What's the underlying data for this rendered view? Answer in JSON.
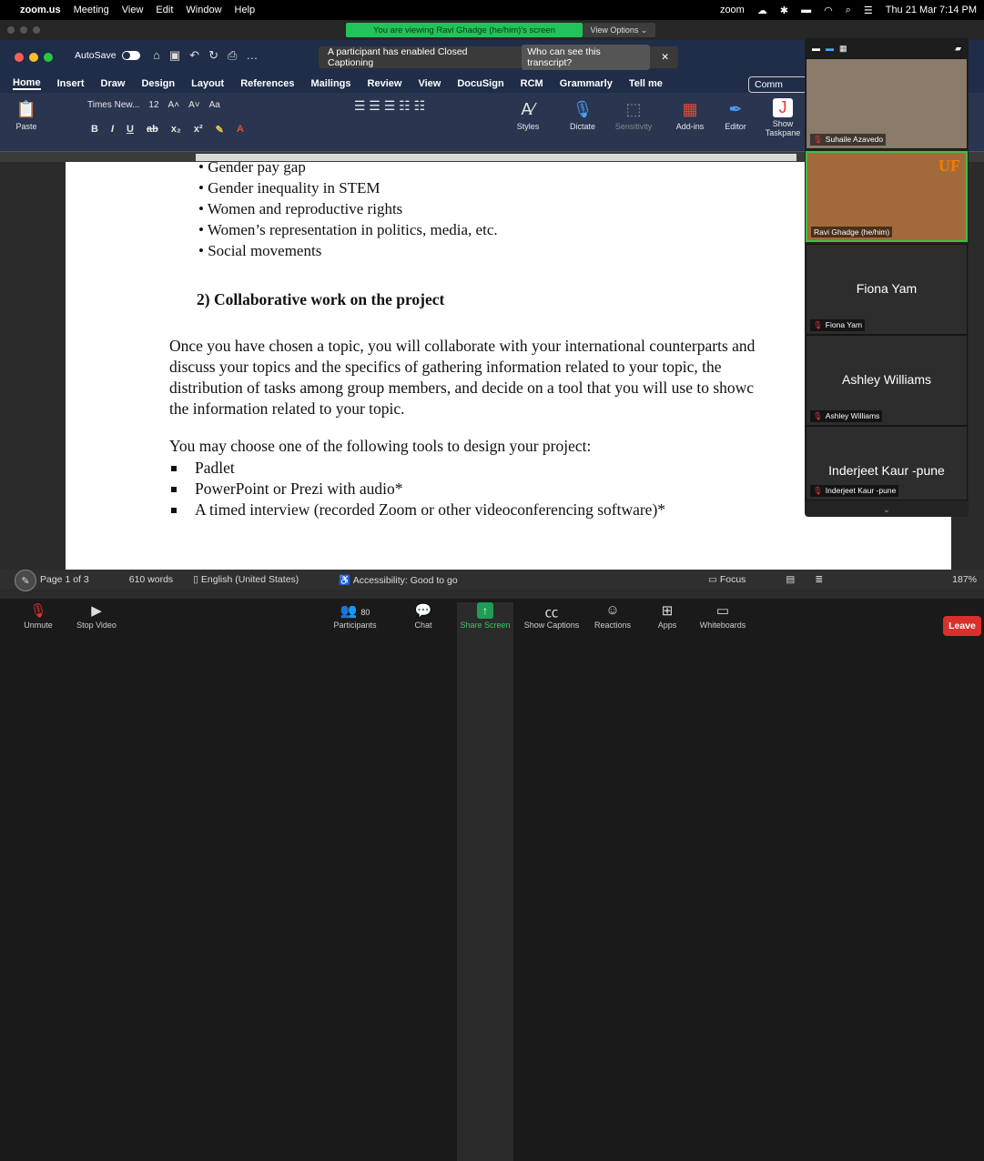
{
  "menubar": {
    "app": "zoom.us",
    "items": [
      "Meeting",
      "View",
      "Edit",
      "Window",
      "Help"
    ],
    "zoom_label": "zoom",
    "datetime": "Thu 21 Mar 7:14 PM"
  },
  "zoom_header": {
    "banner": "You are viewing Ravi Ghadge (he/him)'s screen",
    "view_options": "View Options"
  },
  "word": {
    "autosave": "AutoSave",
    "caption_notice": "A participant has enabled Closed Captioning",
    "caption_link": "Who can see this transcript?",
    "tabs": [
      "Home",
      "Insert",
      "Draw",
      "Design",
      "Layout",
      "References",
      "Mailings",
      "Review",
      "View",
      "DocuSign",
      "RCM",
      "Grammarly",
      "Tell me"
    ],
    "comments": "Comm",
    "font_name": "Times New...",
    "font_size": "12",
    "ribbon_buttons": {
      "paste": "Paste",
      "styles": "Styles",
      "dictate": "Dictate",
      "sensitivity": "Sensitivity",
      "addins": "Add-ins",
      "editor": "Editor",
      "show": "Show",
      "taskpane": "Taskpane"
    }
  },
  "document": {
    "bullets": [
      "Gender pay gap",
      "Gender inequality in STEM",
      "Women and reproductive rights",
      "Women’s representation in politics, media, etc.",
      "Social movements"
    ],
    "heading": "2) Collaborative work on the project",
    "paragraph_lines": [
      "Once you have chosen a topic, you will collaborate with your international counterparts and",
      "discuss your topics and the specifics of gathering information related to your topic, the",
      "distribution of tasks among group members, and decide on a tool that you will use to showc",
      "the information related to your topic."
    ],
    "tools_intro": "You may choose one of the following tools to design your project:",
    "tools": [
      "Padlet",
      "PowerPoint or Prezi with audio*",
      "A timed interview (recorded Zoom or other videoconferencing software)*"
    ]
  },
  "statusbar": {
    "page": "1 of 3",
    "words": "610 words",
    "language": "English (United States)",
    "accessibility": "Accessibility: Good to go",
    "focus": "Focus",
    "zoom": "187%"
  },
  "participants": [
    {
      "name": "Suhaile Azavedo",
      "video": true
    },
    {
      "name": "Ravi Ghadge (he/him)",
      "video": true,
      "speaking": true,
      "logo": "UF"
    },
    {
      "name": "Fiona Yam",
      "video": false
    },
    {
      "name": "Ashley Williams",
      "video": false
    },
    {
      "name": "Inderjeet Kaur -pune",
      "video": false
    }
  ],
  "controls": {
    "unmute": "Unmute",
    "stop_video": "Stop Video",
    "participants": "Participants",
    "participants_count": "80",
    "chat": "Chat",
    "share_screen": "Share Screen",
    "captions": "Show Captions",
    "reactions": "Reactions",
    "apps": "Apps",
    "whiteboards": "Whiteboards",
    "leave": "Leave"
  }
}
